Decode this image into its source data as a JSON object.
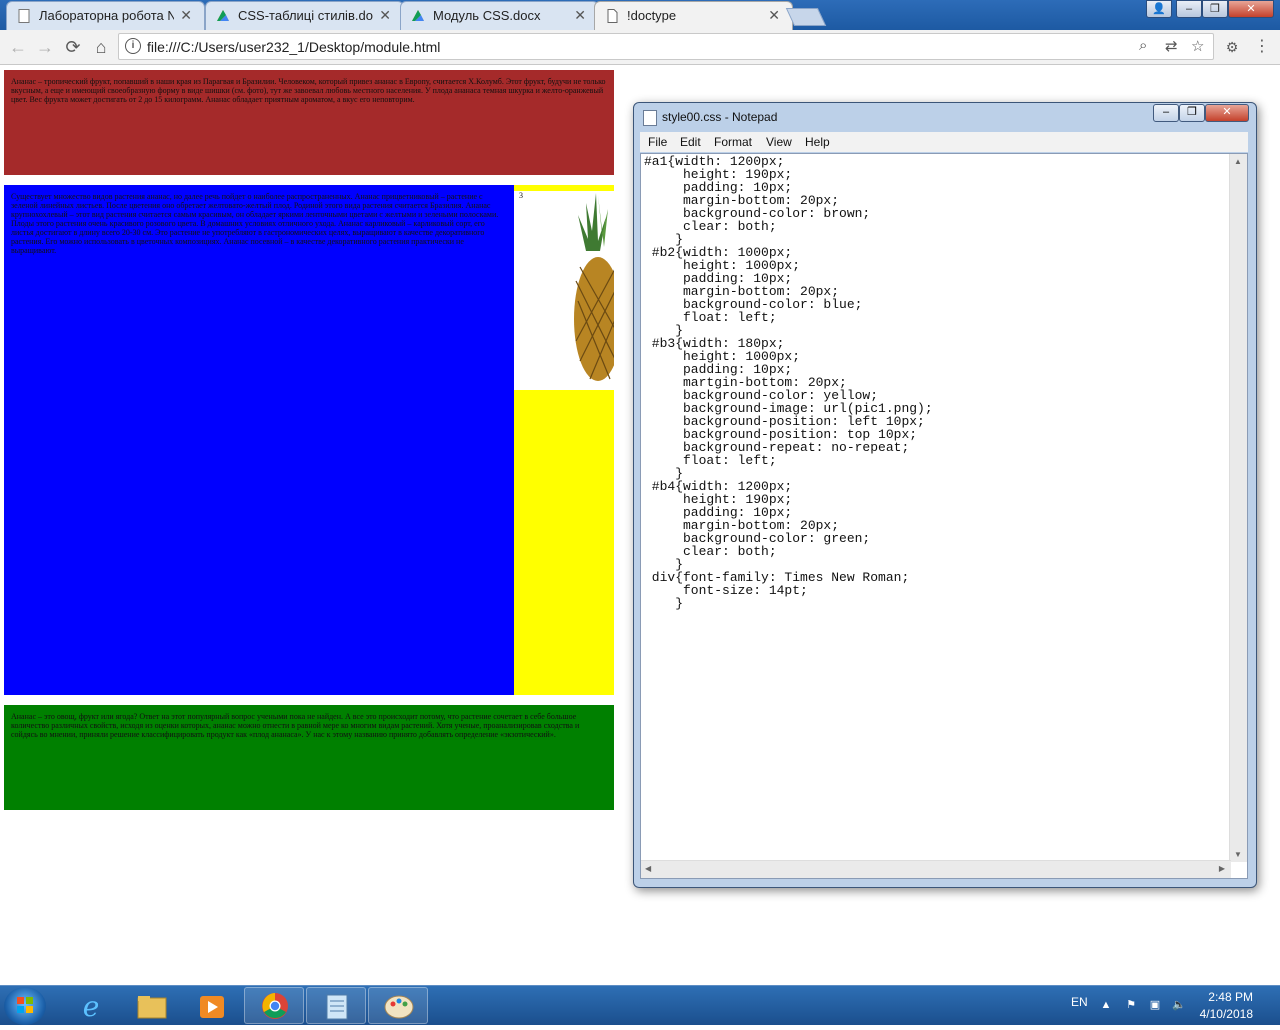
{
  "browser": {
    "tabs": [
      {
        "title": "Лабораторна робота №",
        "icon": "document-icon"
      },
      {
        "title": "CSS-таблиці стилів.doc",
        "icon": "google-drive-icon"
      },
      {
        "title": "Модуль CSS.docx",
        "icon": "google-drive-icon"
      },
      {
        "title": "!doctype",
        "icon": "page-icon",
        "active": true
      }
    ],
    "address": "file:///C:/Users/user232_1/Desktop/module.html"
  },
  "page": {
    "a1_text": "Ананас – тропический фрукт, попавший в наши края из Парагвая и Бразилии. Человеком, который привез ананас в Европу, считается Х.Колумб. Этот фрукт, будучи не только вкусным, а еще и имеющий своеобразную форму в виде шишки (см. фото), тут же завоевал любовь местного населения. У плода ананаса темная шкурка и желто-оранжевый цвет. Вес фрукта может достигать от 2 до 15 килограмм. Ананас обладает приятным ароматом, а вкус его неповторим.",
    "b2_text": "Существует множество видов растения ананас, но далее речь пойдет о наиболее распространенных. Ананас прицветниковый – растение с зеленой линейных листьев. После цветения оно обретает желтовато-желтый плод. Родиной этого вида растения считается Бразилия. Ананас крупнохохлевый – этот вид растения считается самым красивым, он обладает яркими ленточными цветами с желтыми и зелеными полосками. Плоды этого растения очень красивого розового цвета. В домашних условиях отличного ухода. Ананас карликовый – карликовый сорт, его листья достигают в длину всего 20-30 см. Это растение не употребляют в гастрономических целях, выращивают в качестве декоративного растения. Его можно использовать в цветочных композициях. Ананас посевной – в качестве декоративного растения практически не выращивают.",
    "b3_label": "3",
    "b4_text": "Ананас – это овощ, фрукт или ягода? Ответ на этот популярный вопрос учеными пока не найден. А все это происходит потому, что растение сочетает в себе большое количество различных свойств, исходя из оценки которых, ананас можно отнести в равной мере ко многим видам растений. Хотя ученые, проанализировав сходства и сойдясь во мнении, приняли решение классифицировать продукт как «плод ананаса». У нас к этому названию принято добавлять определение «экзотический»."
  },
  "notepad": {
    "title": "style00.css - Notepad",
    "menu": [
      "File",
      "Edit",
      "Format",
      "View",
      "Help"
    ],
    "content": "#a1{width: 1200px;\n     height: 190px;\n     padding: 10px;\n     margin-bottom: 20px;\n     background-color: brown;\n     clear: both;\n    }\n #b2{width: 1000px;\n     height: 1000px;\n     padding: 10px;\n     margin-bottom: 20px;\n     background-color: blue;\n     float: left;\n    }\n #b3{width: 180px;\n     height: 1000px;\n     padding: 10px;\n     martgin-bottom: 20px;\n     background-color: yellow;\n     background-image: url(pic1.png);\n     background-position: left 10px;\n     background-position: top 10px;\n     background-repeat: no-repeat;\n     float: left;\n    }\n #b4{width: 1200px;\n     height: 190px;\n     padding: 10px;\n     margin-bottom: 20px;\n     background-color: green;\n     clear: both;\n    }\n div{font-family: Times New Roman;\n     font-size: 14pt;\n    }"
  },
  "taskbar": {
    "lang": "EN",
    "time": "2:48 PM",
    "date": "4/10/2018",
    "apps": [
      "internet-explorer-icon",
      "file-explorer-icon",
      "media-player-icon",
      "chrome-icon",
      "notepad-icon",
      "paint-icon"
    ]
  },
  "colors": {
    "a1": "#a52a2a",
    "b2": "#0000ff",
    "b3": "#ffff00",
    "b4": "#008000"
  }
}
